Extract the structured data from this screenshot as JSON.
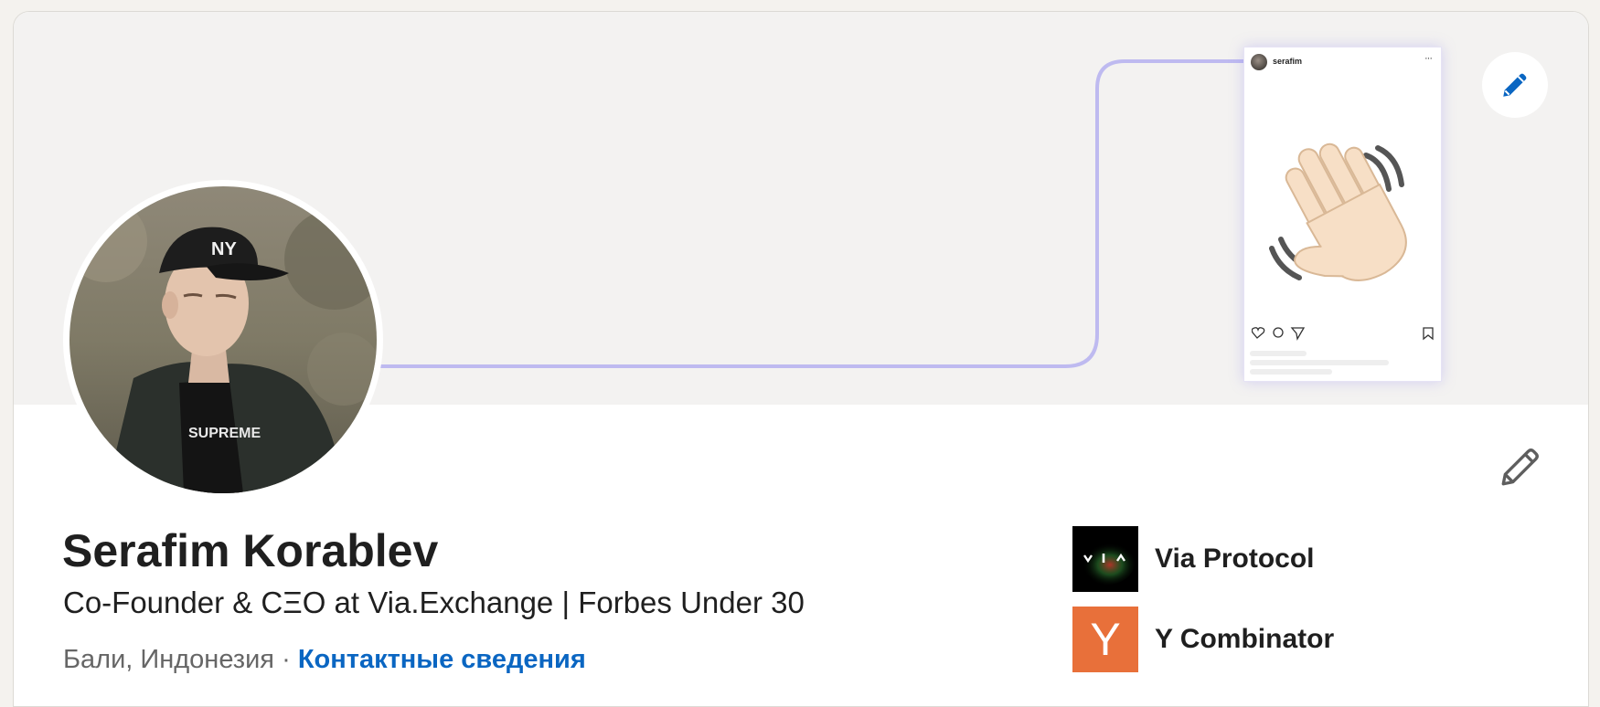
{
  "profile": {
    "name": "Serafim Korablev",
    "headline": "Co-Founder & CΞO at Via.Exchange | Forbes Under 30",
    "location": "Бали, Индонезия",
    "separator": "·",
    "contact_link": "Контактные сведения"
  },
  "banner": {
    "post": {
      "username": "serafim",
      "menu": "···",
      "emoji": "waving-hand"
    },
    "edit_icon": "pencil-icon"
  },
  "intro": {
    "edit_icon": "pencil-icon"
  },
  "organizations": [
    {
      "name": "Via Protocol",
      "logo": "via-protocol-logo",
      "logo_bg": "#000000"
    },
    {
      "name": "Y Combinator",
      "logo": "y-combinator-logo",
      "logo_bg": "#e8703a",
      "logo_letter": "Y"
    }
  ],
  "colors": {
    "link": "#0a66c2",
    "banner_bg": "#f3f2f1",
    "accent_line": "#b3b0ee"
  }
}
